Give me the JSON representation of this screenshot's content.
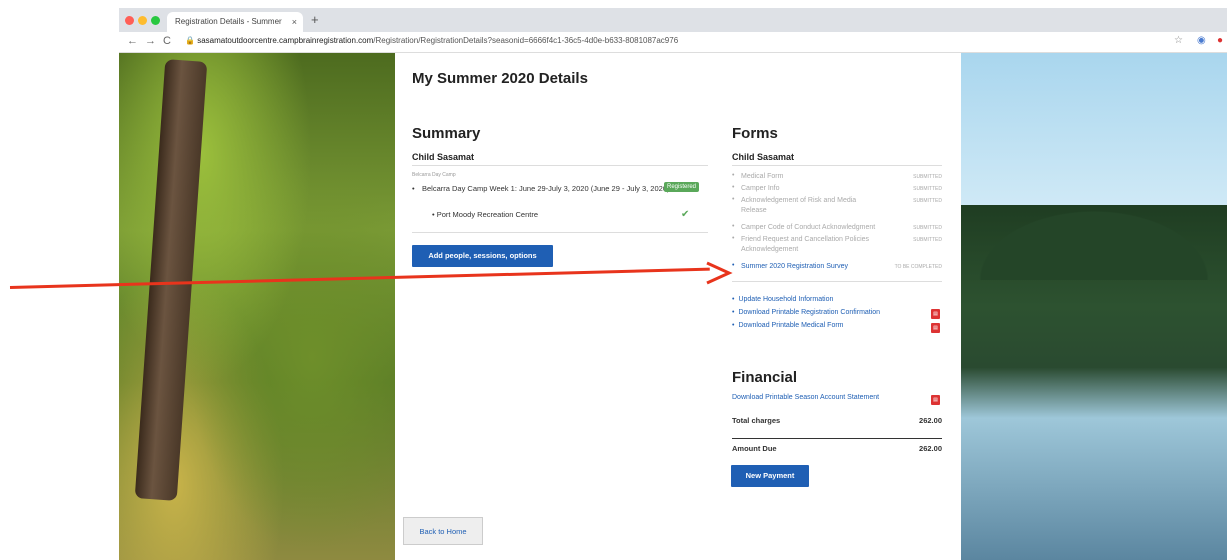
{
  "browser": {
    "tab_title": "Registration Details - Summer",
    "tab_close": "×",
    "new_tab": "+",
    "url_host": "sasamatoutdoorcentre.campbrainregistration.com",
    "url_path": "/Registration/RegistrationDetails?seasonid=6666f4c1-36c5-4d0e-b633-8081087ac976",
    "back": "←",
    "forward": "→",
    "reload": "C"
  },
  "page": {
    "title": "My Summer 2020 Details"
  },
  "summary": {
    "heading": "Summary",
    "child": "Child Sasamat",
    "camp_label": "Belcarra Day Camp",
    "session": "Belcarra Day Camp Week 1: June 29-July 3, 2020 (June 29 - July 3, 2020)",
    "badge": "Registered",
    "location": "Port Moody Recreation Centre",
    "check": "✔",
    "add_button": "Add people, sessions, options"
  },
  "forms": {
    "heading": "Forms",
    "child": "Child Sasamat",
    "items": [
      {
        "name": "Medical Form",
        "status": "SUBMITTED"
      },
      {
        "name": "Camper Info",
        "status": "SUBMITTED"
      },
      {
        "name": "Acknowledgement of Risk and Media Release",
        "status": "SUBMITTED"
      },
      {
        "name": "Camper Code of Conduct Acknowledgment",
        "status": "SUBMITTED"
      },
      {
        "name": "Friend Request and Cancellation Policies Acknowledgement",
        "status": "SUBMITTED"
      },
      {
        "name": "Summer 2020 Registration Survey",
        "status": "TO BE COMPLETED"
      }
    ],
    "links": [
      {
        "label": "Update Household Information"
      },
      {
        "label": "Download Printable Registration Confirmation"
      },
      {
        "label": "Download Printable Medical Form"
      }
    ]
  },
  "financial": {
    "heading": "Financial",
    "statement_link": "Download Printable Season Account Statement",
    "total_label": "Total charges",
    "total_value": "262.00",
    "due_label": "Amount Due",
    "due_value": "262.00",
    "payment_button": "New Payment"
  },
  "footer": {
    "back_button": "Back to Home"
  },
  "colors": {
    "accent": "#1f5fb4",
    "badge": "#5aa85a",
    "arrow": "#e8341c"
  }
}
